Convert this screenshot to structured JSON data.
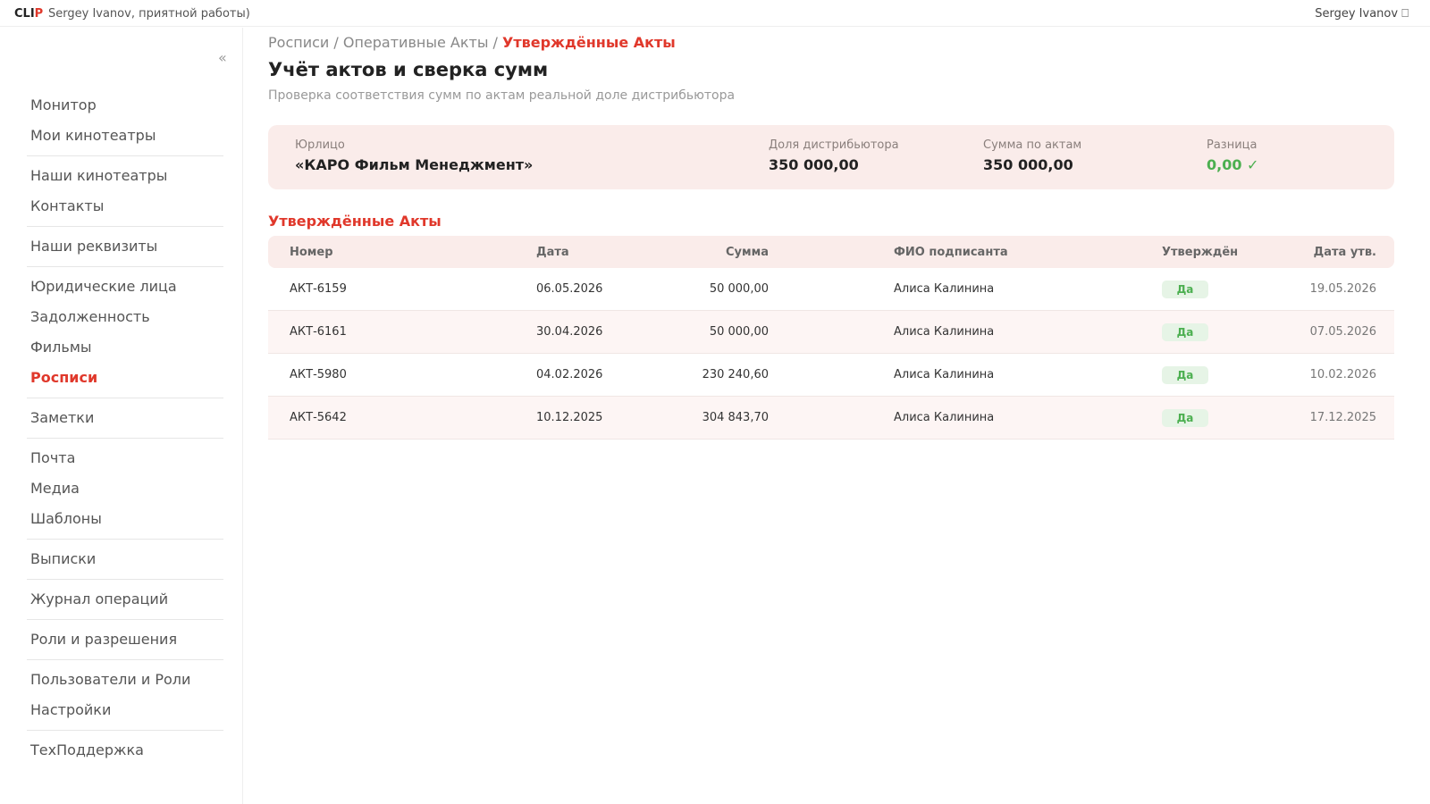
{
  "topbar": {
    "logo_a": "CLI",
    "logo_b": "P",
    "greeting": "Sergey Ivanov, приятной работы)",
    "user": "Sergey Ivanov ⎕"
  },
  "sidebar": {
    "collapse": "«",
    "groups": [
      [
        "Монитор",
        "Мои кинотеатры"
      ],
      [
        "Наши кинотеатры",
        "Контакты"
      ],
      [
        "Наши реквизиты"
      ],
      [
        "Юридические лица",
        "Задолженность",
        "Фильмы",
        "Росписи"
      ],
      [
        "Заметки"
      ],
      [
        "Почта",
        "Медиа",
        "Шаблоны"
      ],
      [
        "Выписки"
      ],
      [
        "Журнал операций"
      ],
      [
        "Роли и разрешения"
      ],
      [
        "Пользователи и Роли",
        "Настройки"
      ],
      [
        "ТехПоддержка"
      ]
    ],
    "active": "Росписи"
  },
  "breadcrumb": {
    "items": [
      "Росписи",
      "Оперативные Акты"
    ],
    "separator": " / ",
    "current": "Утверждённые Акты"
  },
  "page": {
    "title": "Учёт актов и сверка сумм",
    "subtitle": "Проверка соответствия сумм по актам реальной доле дистрибьютора"
  },
  "summary": {
    "entity_label": "Юрлицо",
    "entity_value": "«КАРО Фильм Менеджмент»",
    "share_label": "Доля дистрибьютора",
    "share_value": "350 000,00",
    "acts_label": "Сумма по актам",
    "acts_value": "350 000,00",
    "diff_label": "Разница",
    "diff_value": "0,00 ✓",
    "diff_color": "#4caf50"
  },
  "section": {
    "title": "Утверждённые Акты"
  },
  "table": {
    "headers": {
      "number": "Номер",
      "date": "Дата",
      "sum": "Сумма",
      "signer": "ФИО подписанта",
      "approved": "Утверждён",
      "approved_date": "Дата утв."
    },
    "rows": [
      {
        "number": "АКТ-6159",
        "date": "06.05.2026",
        "sum": "50 000,00",
        "signer": "Алиса Калинина",
        "approved": "Да",
        "approved_date": "19.05.2026"
      },
      {
        "number": "АКТ-6161",
        "date": "30.04.2026",
        "sum": "50 000,00",
        "signer": "Алиса Калинина",
        "approved": "Да",
        "approved_date": "07.05.2026"
      },
      {
        "number": "АКТ-5980",
        "date": "04.02.2026",
        "sum": "230 240,60",
        "signer": "Алиса Калинина",
        "approved": "Да",
        "approved_date": "10.02.2026"
      },
      {
        "number": "АКТ-5642",
        "date": "10.12.2025",
        "sum": "304 843,70",
        "signer": "Алиса Калинина",
        "approved": "Да",
        "approved_date": "17.12.2025"
      }
    ]
  },
  "colors": {
    "accent": "#e0382b",
    "success": "#4caf50",
    "card_bg": "#faecea"
  }
}
